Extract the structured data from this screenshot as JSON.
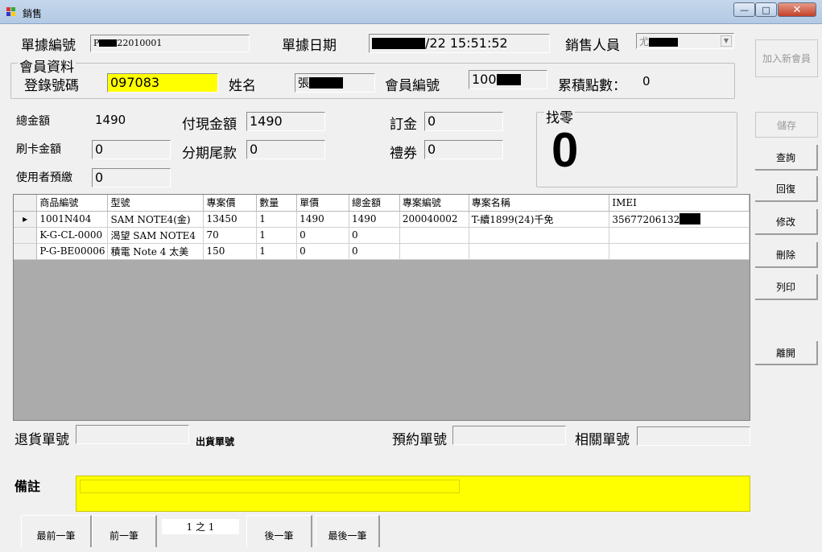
{
  "window": {
    "title": "銷售",
    "minimize_glyph": "—",
    "maximize_glyph": "□",
    "close_glyph": "✕"
  },
  "header": {
    "doc_no_label": "單據編號",
    "doc_no_prefix": "P",
    "doc_no_suffix": "22010001",
    "doc_date_label": "單據日期",
    "doc_date_value": "/22 15:51:52",
    "salesperson_label": "銷售人員",
    "salesperson_value": "尤"
  },
  "member": {
    "group_title": "會員資料",
    "phone_label": "登錄號碼",
    "phone_value": "097083",
    "name_label": "姓名",
    "name_value": "張",
    "member_no_label": "會員編號",
    "member_no_value": "100",
    "points_label": "累積點數：",
    "points_value": "0"
  },
  "payment": {
    "total_label": "總金額",
    "total_value": "1490",
    "cash_label": "付現金額",
    "cash_value": "1490",
    "deposit_label": "訂金",
    "deposit_value": "0",
    "card_label": "刷卡金額",
    "card_value": "0",
    "installment_label": "分期尾款",
    "installment_value": "0",
    "voucher_label": "禮券",
    "voucher_value": "0",
    "prepaid_label": "使用者預繳",
    "prepaid_value": "0",
    "change_label": "找零",
    "change_value": "0"
  },
  "side_buttons": {
    "add_member": "加入新會員",
    "save": "儲存",
    "query": "查詢",
    "restore": "回復",
    "edit": "修改",
    "delete": "刪除",
    "print": "列印",
    "leave": "離開"
  },
  "grid": {
    "columns": [
      "商品編號",
      "型號",
      "專案價",
      "數量",
      "單價",
      "總金額",
      "專案編號",
      "專案名稱",
      "IMEI"
    ],
    "current_row_marker": "▸",
    "rows": [
      [
        "1001N404",
        "SAM NOTE4(金)",
        "13450",
        "1",
        "1490",
        "1490",
        "200040002",
        "T-續1899(24)千免",
        "35677206132"
      ],
      [
        "K-G-CL-0000",
        "渴望 SAM NOTE4",
        "70",
        "1",
        "0",
        "0",
        "",
        "",
        ""
      ],
      [
        "P-G-BE00006",
        "積電 Note 4 太美",
        "150",
        "1",
        "0",
        "0",
        "",
        "",
        ""
      ]
    ]
  },
  "bottom": {
    "return_no_label": "退貨單號",
    "return_no_value": "",
    "shipment_no_label": "出貨單號",
    "reservation_no_label": "預約單號",
    "reservation_no_value": "",
    "related_no_label": "相關單號",
    "related_no_value": "",
    "remarks_label": "備註",
    "remarks_value": ""
  },
  "nav": {
    "first": "最前一筆",
    "prev": "前一筆",
    "page": "1 之 1",
    "next": "後一筆",
    "last": "最後一筆"
  },
  "colors": {
    "highlight_yellow": "#ffff00",
    "window_bg": "#f0f0f0",
    "grid_empty_bg": "#ababab"
  }
}
